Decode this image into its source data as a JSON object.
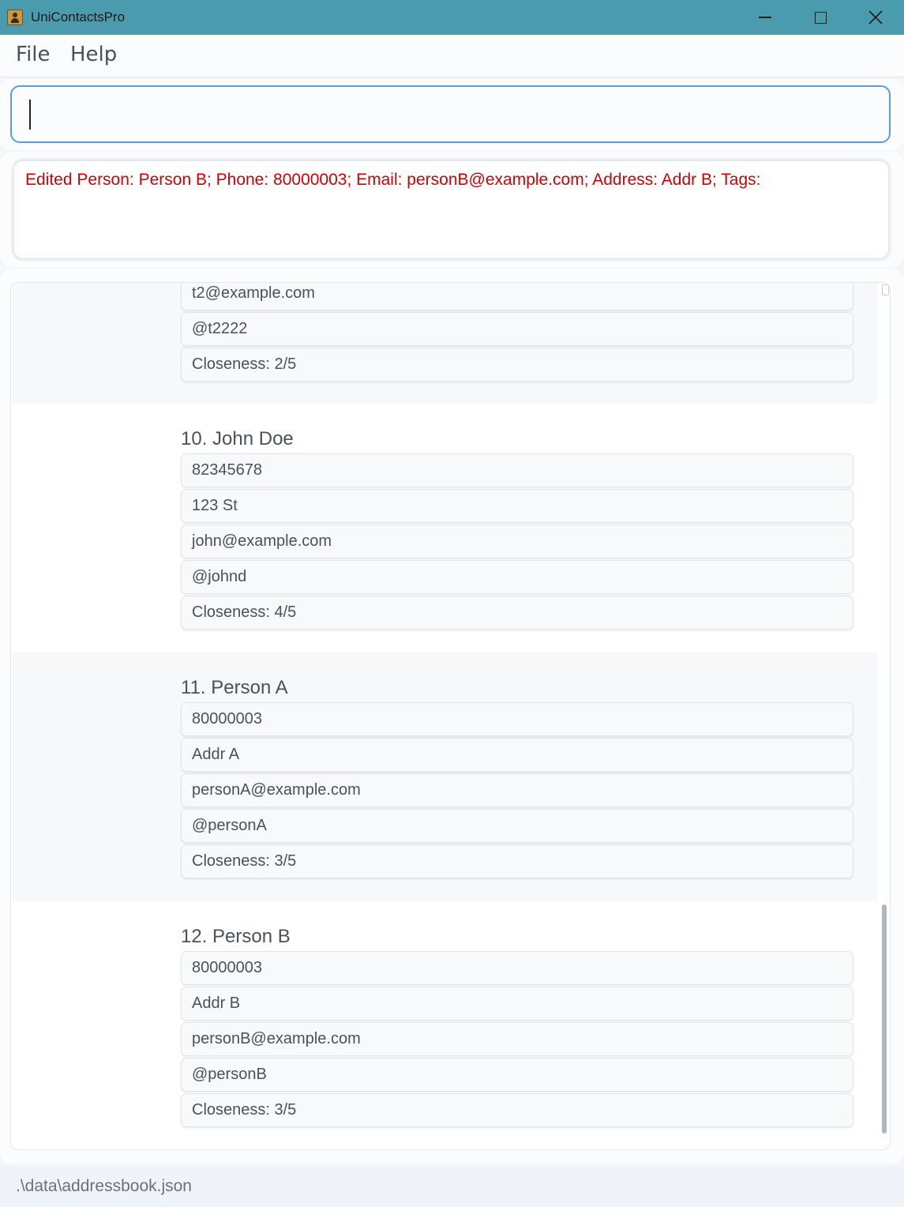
{
  "window": {
    "title": "UniContactsPro",
    "icons": {
      "app": "contacts-book-icon",
      "minimize": "minimize-icon",
      "maximize": "maximize-icon",
      "close": "close-icon"
    }
  },
  "menu": {
    "file": "File",
    "help": "Help"
  },
  "command": {
    "value": ""
  },
  "result": {
    "text": "Edited Person: Person B; Phone: 80000003; Email: personB@example.com; Address: Addr B; Tags:"
  },
  "persons": [
    {
      "title": "",
      "fields": [
        "t2@example.com",
        "@t2222",
        "Closeness: 2/5"
      ]
    },
    {
      "title": "10.  John Doe",
      "fields": [
        "82345678",
        "123 St",
        "john@example.com",
        "@johnd",
        "Closeness: 4/5"
      ]
    },
    {
      "title": "11.  Person A",
      "fields": [
        "80000003",
        "Addr A",
        "personA@example.com",
        "@personA",
        "Closeness: 3/5"
      ]
    },
    {
      "title": "12.  Person B",
      "fields": [
        "80000003",
        "Addr B",
        "personB@example.com",
        "@personB",
        "Closeness: 3/5"
      ]
    }
  ],
  "status": {
    "file_path": ".\\data\\addressbook.json"
  }
}
